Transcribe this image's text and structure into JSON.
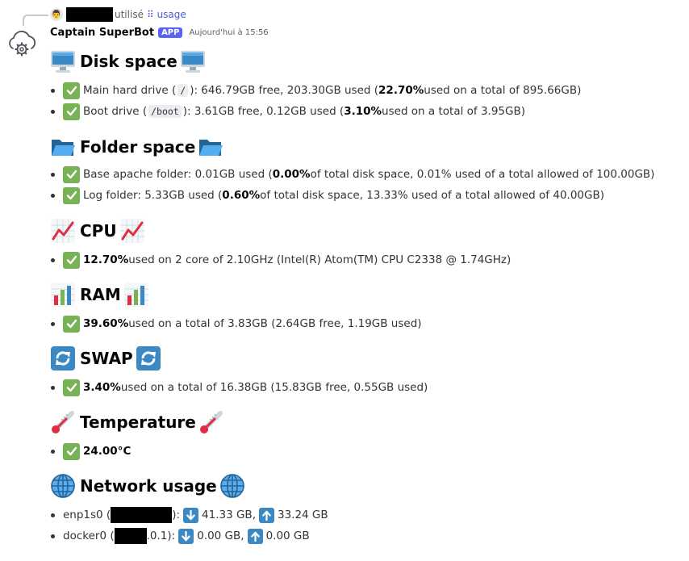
{
  "reply": {
    "verb": "utilisé",
    "command": "usage"
  },
  "message": {
    "username": "Captain SuperBot",
    "badge": "APP",
    "timestamp": "Aujourd'hui à 15:56"
  },
  "disk": {
    "title": "Disk space",
    "items": [
      {
        "pre": "Main hard drive (",
        "path": "/",
        "mid": "): 646.79GB free, 203.30GB used (",
        "pct": "22.70%",
        "post": " used on a total of 895.66GB)"
      },
      {
        "pre": "Boot drive (",
        "path": "/boot",
        "mid": "): 3.61GB free, 0.12GB used (",
        "pct": "3.10%",
        "post": " used on a total of 3.95GB)"
      }
    ]
  },
  "folder": {
    "title": "Folder space",
    "items": [
      {
        "pre": "Base apache folder: 0.01GB used (",
        "pct": "0.00%",
        "post": " of total disk space, 0.01% used of a total allowed of 100.00GB)"
      },
      {
        "pre": "Log folder: 5.33GB used (",
        "pct": "0.60%",
        "post": " of total disk space, 13.33% used of a total allowed of 40.00GB)"
      }
    ]
  },
  "cpu": {
    "title": "CPU",
    "pct": "12.70%",
    "post": " used on 2 core of 2.10GHz (Intel(R) Atom(TM) CPU C2338 @ 1.74GHz)"
  },
  "ram": {
    "title": "RAM",
    "pct": "39.60%",
    "post": " used on a total of 3.83GB (2.64GB free, 1.19GB used)"
  },
  "swap": {
    "title": "SWAP",
    "pct": "3.40%",
    "post": " used on a total of 16.38GB (15.83GB free, 0.55GB used)"
  },
  "temperature": {
    "title": "Temperature",
    "value": "24.00°C"
  },
  "network": {
    "title": "Network usage",
    "items": [
      {
        "name": "enp1s0 (",
        "tail": "",
        "close": "): ",
        "down": "41.33 GB,",
        "up": "33.24 GB"
      },
      {
        "name": "docker0 (",
        "tail": ".0.1",
        "close": "): ",
        "down": "0.00 GB,",
        "up": "0.00 GB"
      }
    ]
  },
  "icons": {
    "disk": "desktop-computer-icon",
    "folder": "open-folder-icon",
    "cpu": "chart-increasing-icon",
    "ram": "bar-chart-icon",
    "swap": "arrows-counterclockwise-icon",
    "temperature": "thermometer-icon",
    "network": "globe-icon",
    "ok": "check-mark-button-icon",
    "down": "down-arrow-icon",
    "up": "up-arrow-icon"
  }
}
